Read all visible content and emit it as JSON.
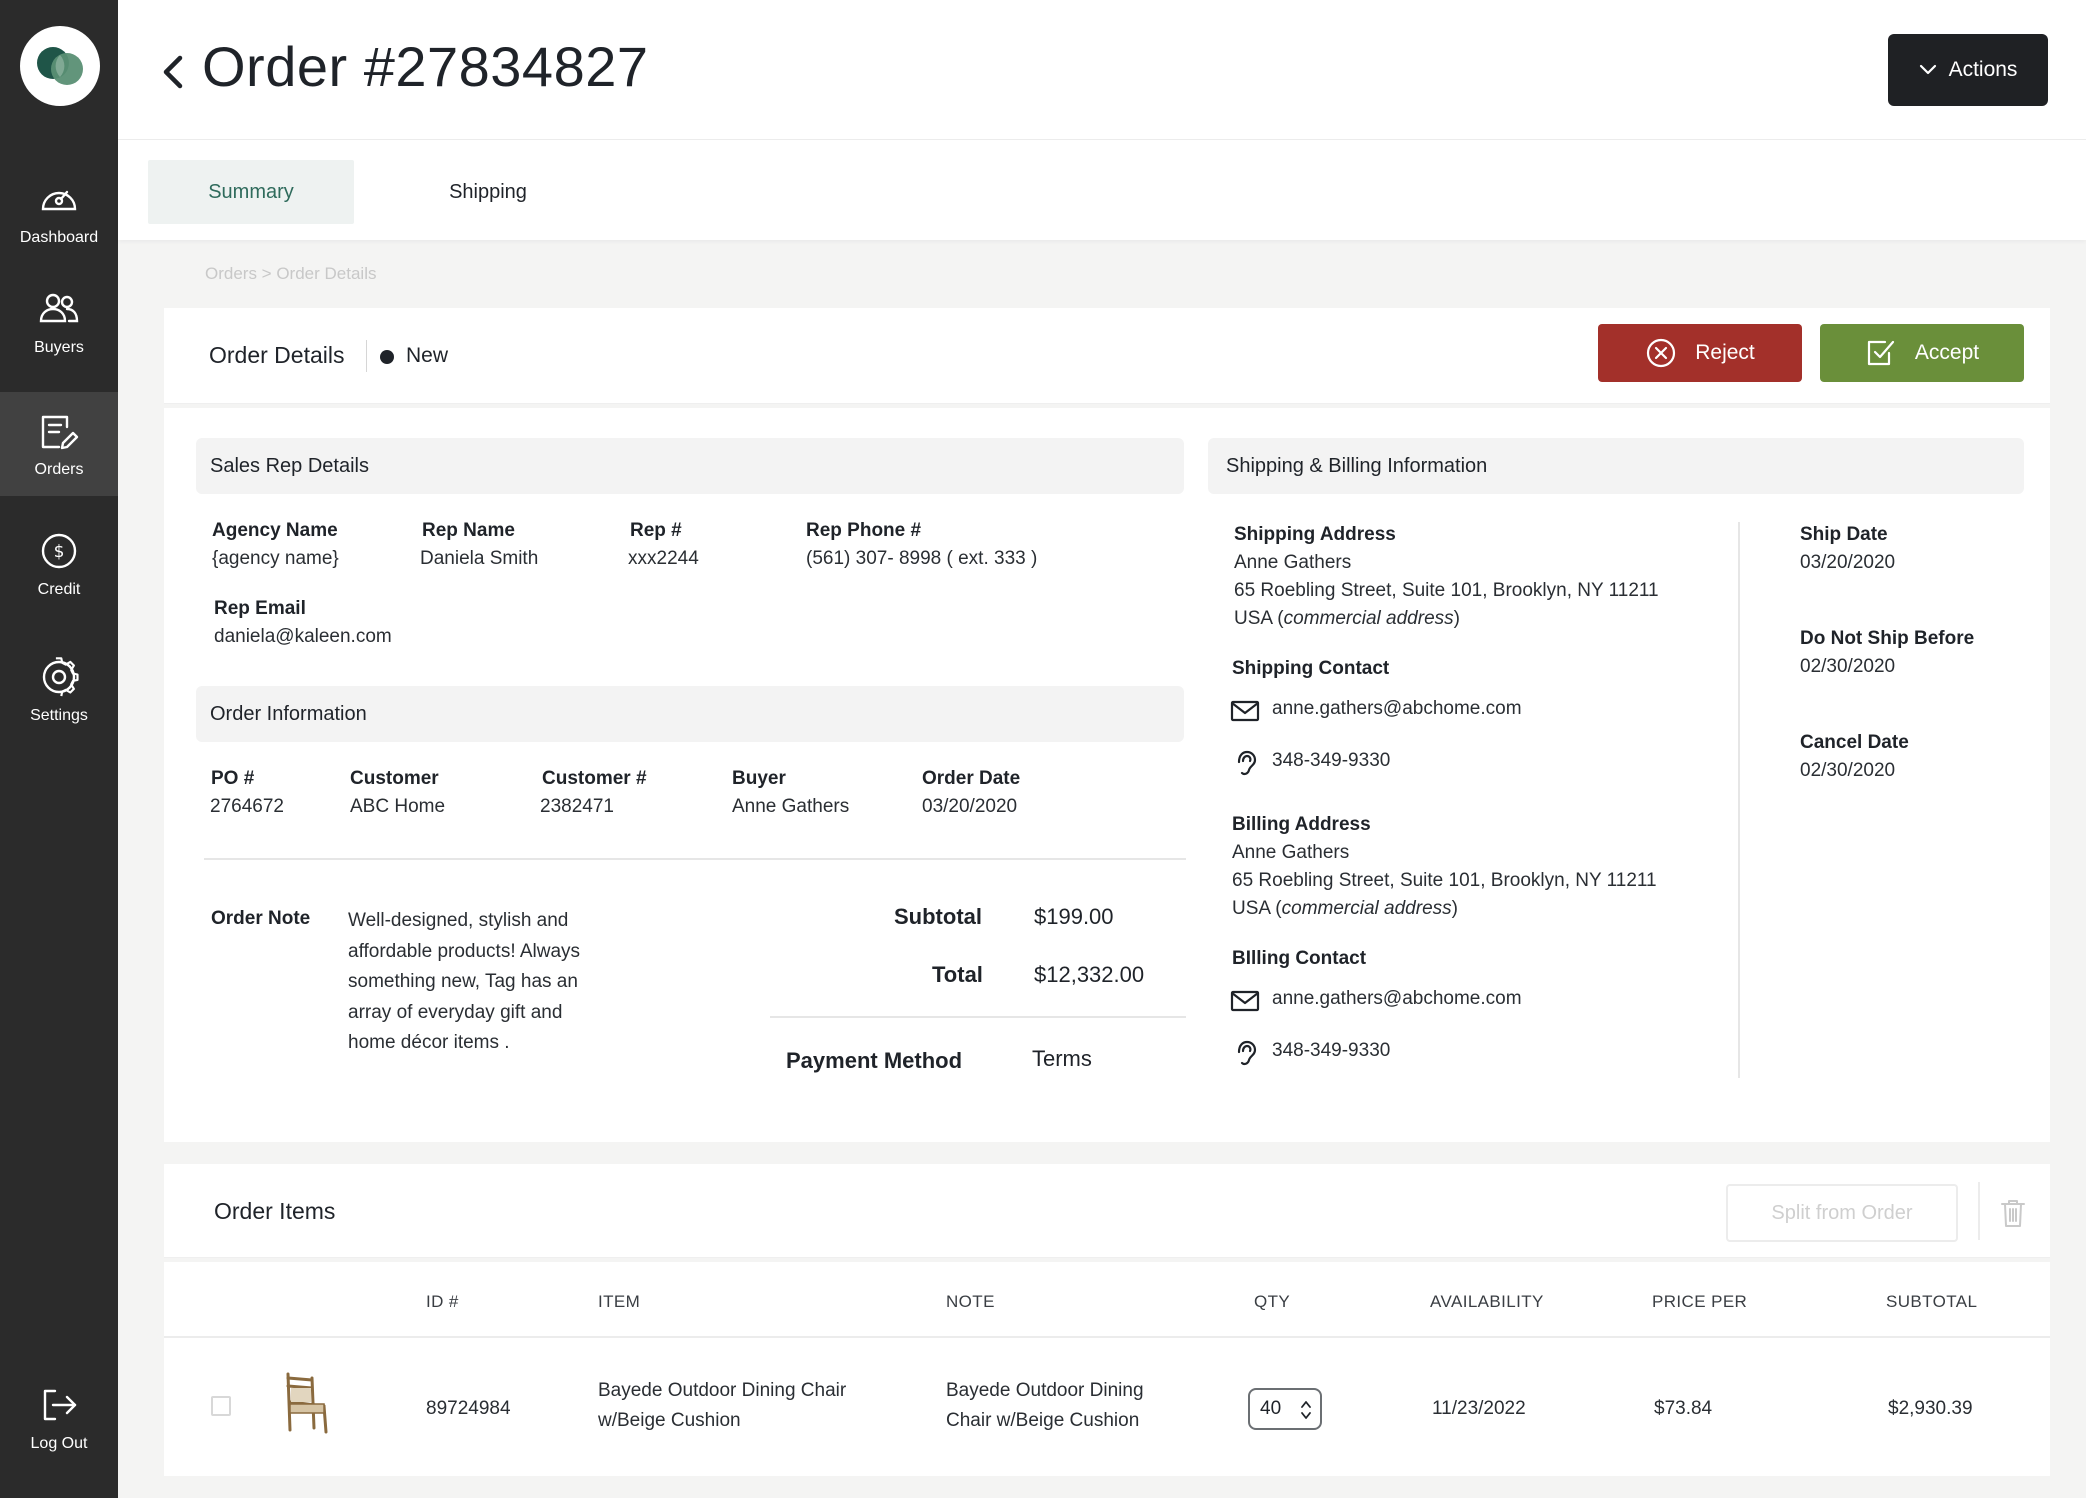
{
  "sidebar": {
    "items": [
      {
        "label": "Dashboard",
        "icon": "gauge-icon"
      },
      {
        "label": "Buyers",
        "icon": "users-icon"
      },
      {
        "label": "Orders",
        "icon": "orders-edit-icon"
      },
      {
        "label": "Credit",
        "icon": "dollar-circle-icon"
      },
      {
        "label": "Settings",
        "icon": "gear-icon"
      }
    ],
    "logout_label": "Log Out"
  },
  "header": {
    "title": "Order #27834827",
    "actions_label": "Actions"
  },
  "tabs": [
    {
      "label": "Summary"
    },
    {
      "label": "Shipping"
    }
  ],
  "breadcrumb": "Orders > Order Details",
  "order_details": {
    "title": "Order Details",
    "status": "New",
    "reject_label": "Reject",
    "accept_label": "Accept"
  },
  "sales_rep": {
    "title": "Sales Rep Details",
    "agency_name_label": "Agency Name",
    "agency_name": "{agency name}",
    "rep_name_label": "Rep Name",
    "rep_name": "Daniela Smith",
    "rep_num_label": "Rep #",
    "rep_num": "xxx2244",
    "rep_phone_label": "Rep Phone #",
    "rep_phone": "(561) 307- 8998 ( ext. 333 )",
    "rep_email_label": "Rep Email",
    "rep_email": "daniela@kaleen.com"
  },
  "order_info": {
    "title": "Order Information",
    "po_label": "PO #",
    "po": "2764672",
    "customer_label": "Customer",
    "customer": "ABC Home",
    "customer_num_label": "Customer #",
    "customer_num": "2382471",
    "buyer_label": "Buyer",
    "buyer": "Anne Gathers",
    "order_date_label": "Order Date",
    "order_date": "03/20/2020",
    "note_label": "Order Note",
    "note_lines": [
      "Well-designed, stylish and",
      "affordable products!  Always",
      "something new, Tag has an",
      "array of everyday gift and",
      "home décor items ."
    ],
    "subtotal_label": "Subtotal",
    "subtotal": "$199.00",
    "total_label": "Total",
    "total": "$12,332.00",
    "payment_label": "Payment Method",
    "payment": "Terms"
  },
  "shipping_billing": {
    "title": "Shipping & Billing Information",
    "shipping_address_label": "Shipping Address",
    "shipping_name": "Anne Gathers",
    "shipping_street": "65 Roebling Street, Suite 101, Brooklyn, NY 11211",
    "shipping_country": "USA",
    "shipping_note": "commercial address",
    "shipping_contact_label": "Shipping Contact",
    "shipping_email": "anne.gathers@abchome.com",
    "shipping_phone": "348-349-9330",
    "billing_address_label": "Billing Address",
    "billing_name": "Anne Gathers",
    "billing_street": "65 Roebling Street, Suite 101, Brooklyn, NY 11211",
    "billing_country": "USA",
    "billing_note": "commercial address",
    "billing_contact_label": "BIlling Contact",
    "billing_email": "anne.gathers@abchome.com",
    "billing_phone": "348-349-9330",
    "ship_date_label": "Ship Date",
    "ship_date": "03/20/2020",
    "do_not_ship_label": "Do Not Ship Before",
    "do_not_ship": "02/30/2020",
    "cancel_date_label": "Cancel Date",
    "cancel_date": "02/30/2020"
  },
  "order_items": {
    "title": "Order Items",
    "split_label": "Split from Order",
    "columns": [
      "ID #",
      "ITEM",
      "NOTE",
      "QTY",
      "AVAILABILITY",
      "PRICE PER",
      "SUBTOTAL"
    ],
    "rows": [
      {
        "id": "89724984",
        "item_lines": [
          "Bayede Outdoor Dining Chair",
          "w/Beige Cushion"
        ],
        "note_lines": [
          "Bayede Outdoor Dining",
          "Chair w/Beige Cushion"
        ],
        "qty": "40",
        "availability": "11/23/2022",
        "price_per": "$73.84",
        "subtotal": "$2,930.39"
      }
    ]
  },
  "colors": {
    "sidebar": "#2b2b2b",
    "accent_green": "#2f6b5c",
    "reject": "#a3302a",
    "accept": "#6a8f3a"
  }
}
